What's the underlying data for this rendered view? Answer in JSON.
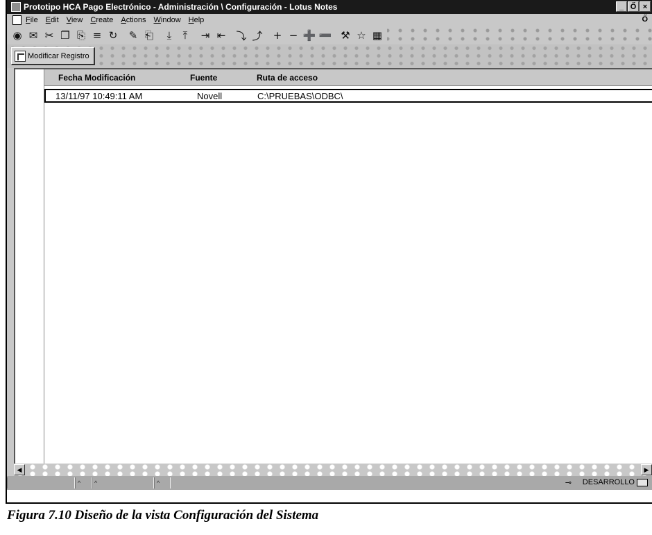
{
  "window": {
    "title": "Prototipo HCA Pago Electrónico - Administración \\ Configuración - Lotus Notes",
    "buttons": [
      "_",
      "Ő",
      "×"
    ]
  },
  "menu": {
    "items": [
      "File",
      "Edit",
      "View",
      "Create",
      "Actions",
      "Window",
      "Help"
    ],
    "restore_glyph": "Ő"
  },
  "toolbar": {
    "icons": [
      "open-database-icon",
      "navigate-icon",
      "cut-icon",
      "copy-icon",
      "paste-icon",
      "properties-icon",
      "refresh-icon",
      "edit-document-icon",
      "compose-icon",
      "collapse-icon",
      "expand-icon",
      "previous-icon",
      "next-icon",
      "previous-main-icon",
      "next-main-icon",
      "expand-all-icon",
      "collapse-all-icon",
      "move-to-folder-icon",
      "remove-from-folder-icon",
      "search-icon",
      "find-icon",
      "table-icon"
    ],
    "glyphs": [
      "◉",
      "✉",
      "✂",
      "❐",
      "⎘",
      "≡",
      "↻",
      "✎",
      "⎗",
      "⤓",
      "⤒",
      "⇥",
      "⇤",
      "⤵",
      "⤴",
      "+",
      "−",
      "➕",
      "➖",
      "⚒",
      "☆",
      "▦"
    ]
  },
  "action_bar": {
    "button_label": "Modificar Registro"
  },
  "view": {
    "columns": [
      "Fecha Modificación",
      "Fuente",
      "Ruta de acceso"
    ],
    "rows": [
      {
        "fecha": "13/11/97 10:49:11 AM",
        "fuente": "Novell",
        "ruta": "C:\\PRUEBAS\\ODBC\\"
      }
    ]
  },
  "scrollbar": {
    "left_arrow": "◀",
    "right_arrow": "▶"
  },
  "statusbar": {
    "segments": [
      "^",
      "^",
      "^"
    ],
    "location": "DESARROLLO"
  },
  "caption": "Figura 7.10 Diseño de la vista Configuración del Sistema"
}
